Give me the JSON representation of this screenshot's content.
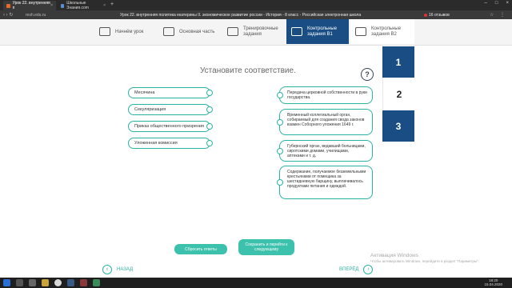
{
  "browser": {
    "tabs": [
      {
        "label": "Урок 22. внутренняя п",
        "close": "×"
      },
      {
        "label": "Школьные Знания.com",
        "close": "×"
      }
    ],
    "new_tab": "+",
    "window_controls": [
      "–",
      "□",
      "×"
    ],
    "nav_icons": "‹ › ↻",
    "url": "resh.edu.ru",
    "page_title": "Урок 22. внутренняя политика екатерины II. экономическое развитие россии - История - 8 класс - Российская электронная школа",
    "reviews": "16 отзывов",
    "tools": "☆ ⋮"
  },
  "steps": [
    {
      "label": "Начнём урок",
      "icon": "megaphone-icon"
    },
    {
      "label": "Основная часть",
      "icon": "play-icon"
    },
    {
      "label": "Тренировочные задания",
      "icon": "dumbbell-icon"
    },
    {
      "label": "Контрольные задания В1",
      "icon": "target-icon"
    },
    {
      "label": "Контрольные задания В2",
      "icon": "target-icon"
    }
  ],
  "task": {
    "instruction": "Установите соответствие.",
    "help": "?",
    "left_items": [
      "Месячина",
      "Секуляризация",
      "Приказ общественного призрения",
      "Уложенная комиссия"
    ],
    "right_items": [
      "Передача церковной собственности в руки государства.",
      "Временный коллегиальный орган, собираемый для создания свода законов взамен Соборного уложения 1649 г.",
      "Губернский орган, ведавший больницами, сиротскими домами, училищами, аптеками и т. д.",
      "Содержание, получаемое безземельными крестьянами от помещика за шестидневную барщину, выплачивалось продуктами питания и одеждой."
    ]
  },
  "task_numbers": [
    "1",
    "2",
    "3"
  ],
  "buttons": {
    "reset": "Сбросить ответы",
    "save": "Сохранить и перейти к следующему"
  },
  "nav": {
    "back": "НАЗАД",
    "forward": "ВПЕРЁД",
    "back_arrow": "‹",
    "forward_arrow": "›"
  },
  "watermark": {
    "title": "Активация Windows",
    "subtitle": "Чтобы активировать Windows, перейдите в раздел \"Параметры\"."
  },
  "clock": {
    "time": "18:20",
    "date": "15.04.2020"
  },
  "colors": {
    "accent": "#2bb3a3",
    "primary": "#1a4d84",
    "button": "#3cc1ad"
  }
}
